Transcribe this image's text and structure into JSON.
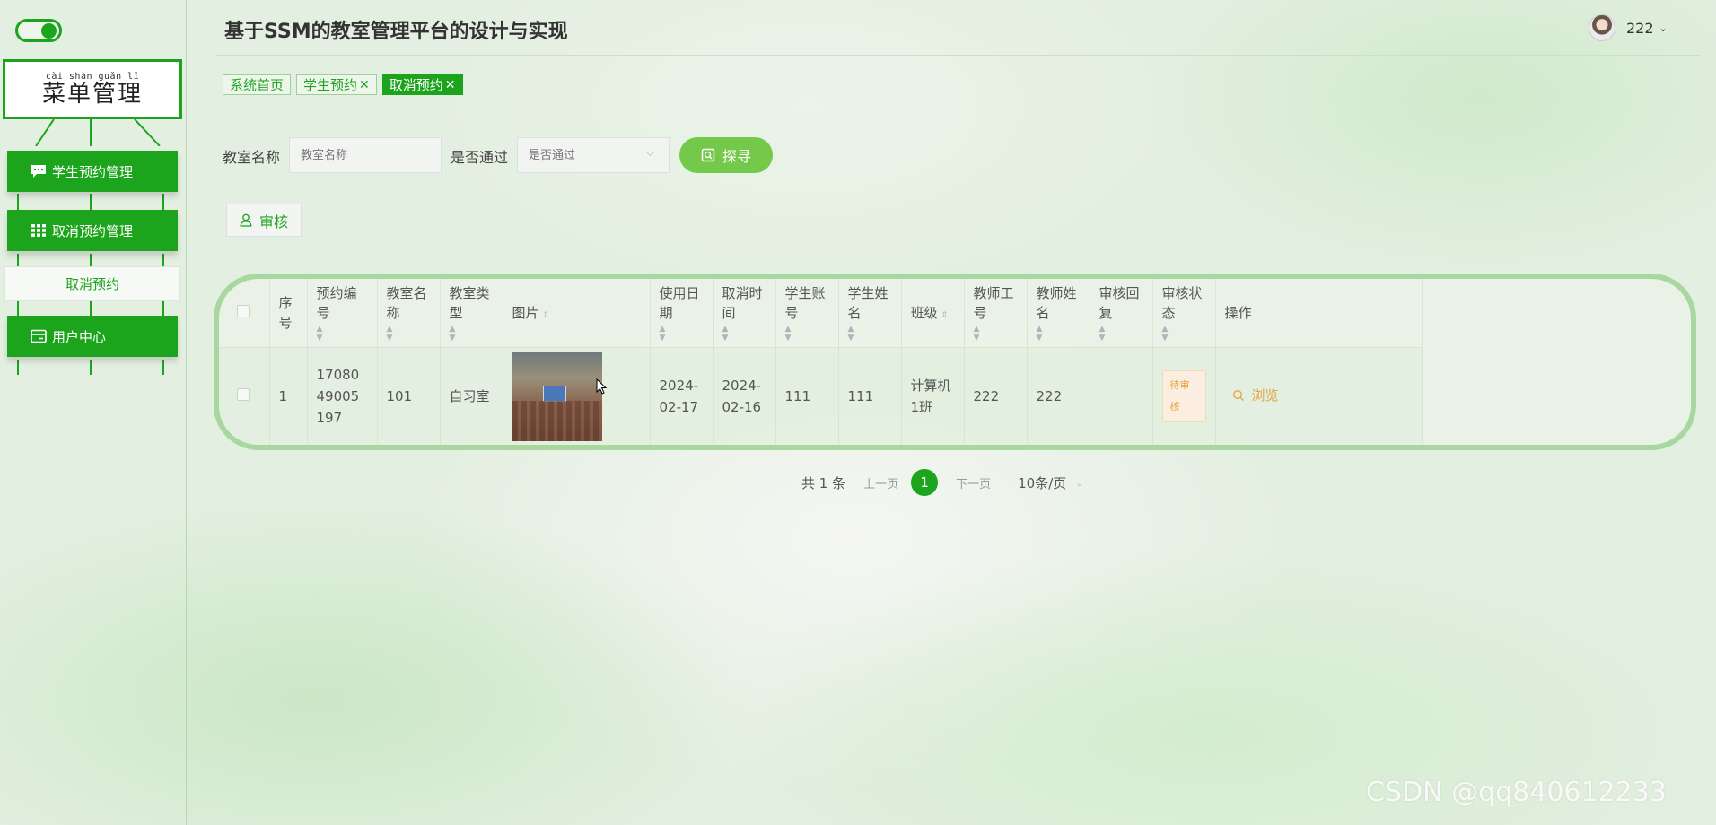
{
  "header": {
    "title": "基于SSM的教室管理平台的设计与实现",
    "user": {
      "name": "222"
    }
  },
  "sidebar": {
    "menu_title": {
      "pinyin": "cài shàn guǎn lǐ",
      "text": "菜单管理"
    },
    "items": [
      {
        "label": "学生预约管理",
        "icon": "chat-bubble-icon"
      },
      {
        "label": "取消预约管理",
        "icon": "grid-icon"
      },
      {
        "label": "用户中心",
        "icon": "card-icon"
      }
    ],
    "sub_item": {
      "label": "取消预约"
    }
  },
  "tags": [
    {
      "label": "系统首页",
      "closable": false,
      "active": false
    },
    {
      "label": "学生预约",
      "closable": true,
      "active": false
    },
    {
      "label": "取消预约",
      "closable": true,
      "active": true
    }
  ],
  "search": {
    "classroom_name_label": "教室名称",
    "classroom_name_placeholder": "教室名称",
    "passed_label": "是否通过",
    "passed_placeholder": "是否通过",
    "search_button": "探寻"
  },
  "toolbar": {
    "audit_button": "审核"
  },
  "table": {
    "headers": [
      "序号",
      "预约编号",
      "教室名称",
      "教室类型",
      "图片",
      "使用日期",
      "取消时间",
      "学生账号",
      "学生姓名",
      "班级",
      "教师工号",
      "教师姓名",
      "审核回复",
      "审核状态",
      "操作"
    ],
    "rows": [
      {
        "index": "1",
        "booking_no": "1708049005197",
        "classroom_name": "101",
        "classroom_type": "自习室",
        "use_date": "2024-02-17",
        "cancel_time": "2024-02-16",
        "student_account": "111",
        "student_name": "111",
        "class": "计算机1班",
        "teacher_no": "222",
        "teacher_name": "222",
        "audit_reply": "",
        "audit_status": "待审核",
        "action": "浏览"
      }
    ]
  },
  "pagination": {
    "total": "共 1 条",
    "prev": "上一页",
    "current": "1",
    "next": "下一页",
    "page_size": "10条/页"
  },
  "watermark": "CSDN @qq840612233",
  "colors": {
    "primary": "#1ca41c",
    "search_button": "#74c94a",
    "warning": "#e6a23c",
    "table_border": "#a8d8a0"
  }
}
